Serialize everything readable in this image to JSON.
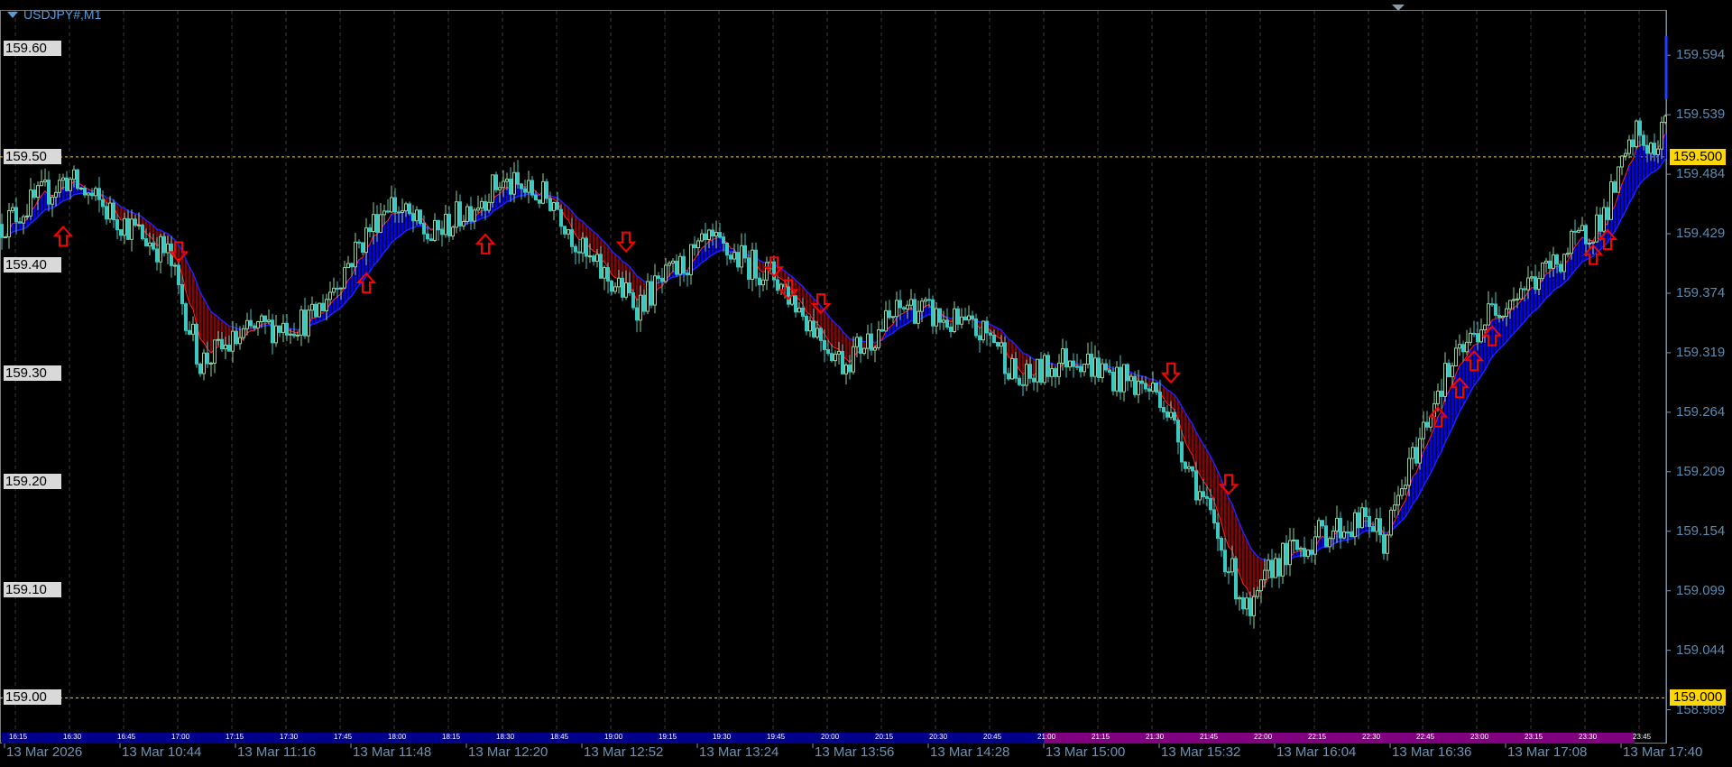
{
  "window": {
    "title": "USDJPY#,M1"
  },
  "left_levels": [
    "159.60",
    "159.50",
    "159.40",
    "159.30",
    "159.20",
    "159.10",
    "159.00"
  ],
  "price_axis": [
    "159.594",
    "159.539",
    "159.484",
    "159.429",
    "159.374",
    "159.319",
    "159.264",
    "159.209",
    "159.154",
    "159.099",
    "159.044",
    "158.989"
  ],
  "price_markers": [
    {
      "label": "159.500",
      "price": 159.5,
      "color": "#ffd700"
    },
    {
      "label": "159.000",
      "price": 159.0,
      "color": "#ffd700"
    }
  ],
  "time_axis": [
    "13 Mar 2026",
    "13 Mar 10:44",
    "13 Mar 11:16",
    "13 Mar 11:48",
    "13 Mar 12:20",
    "13 Mar 12:52",
    "13 Mar 13:24",
    "13 Mar 13:56",
    "13 Mar 14:28",
    "13 Mar 15:00",
    "13 Mar 15:32",
    "13 Mar 16:04",
    "13 Mar 16:36",
    "13 Mar 17:08",
    "13 Mar 17:40"
  ],
  "server_time_bar": {
    "labels": [
      "16:15",
      "16:30",
      "16:45",
      "17:00",
      "17:15",
      "17:30",
      "17:45",
      "18:00",
      "18:15",
      "18:30",
      "18:45",
      "19:00",
      "19:15",
      "19:30",
      "19:45",
      "20:00",
      "20:15",
      "20:30",
      "20:45",
      "21:00",
      "21:15",
      "21:30",
      "21:45",
      "22:00",
      "22:15",
      "22:30",
      "22:45",
      "23:00",
      "23:15",
      "23:30",
      "23:45"
    ],
    "colors": {
      "before_21": "#00008b",
      "after_21": "#800080"
    }
  },
  "colors": {
    "bull": "#8fd19e",
    "bear": "#3cc8c0",
    "fill_up": "#0000ff",
    "fill_down": "#8b0000",
    "ma_fast": "#ff2020",
    "ma_slow": "#2020ff",
    "arrow": "#ff0000",
    "grid": "#3a3a3a"
  },
  "chart_data": {
    "type": "candlestick",
    "symbol": "USDJPY#",
    "timeframe": "M1",
    "ylim": [
      158.98,
      159.61
    ],
    "price_path": [
      [
        "10:12",
        159.44
      ],
      [
        "10:29",
        159.48
      ],
      [
        "10:42",
        159.446
      ],
      [
        "10:57",
        159.41
      ],
      [
        "11:06",
        159.31
      ],
      [
        "11:21",
        159.34
      ],
      [
        "11:37",
        159.35
      ],
      [
        "11:58",
        159.46
      ],
      [
        "12:10",
        159.425
      ],
      [
        "12:29",
        159.476
      ],
      [
        "12:44",
        159.46
      ],
      [
        "12:53",
        159.405
      ],
      [
        "13:07",
        159.364
      ],
      [
        "13:27",
        159.42
      ],
      [
        "13:45",
        159.39
      ],
      [
        "14:04",
        159.31
      ],
      [
        "14:22",
        159.364
      ],
      [
        "14:31",
        159.35
      ],
      [
        "14:46",
        159.333
      ],
      [
        "14:53",
        159.29
      ],
      [
        "15:08",
        159.318
      ],
      [
        "15:17",
        159.3
      ],
      [
        "15:32",
        159.282
      ],
      [
        "15:57",
        159.072
      ],
      [
        "16:03",
        159.123
      ],
      [
        "16:18",
        159.154
      ],
      [
        "16:30",
        159.164
      ],
      [
        "16:34",
        159.144
      ],
      [
        "16:49",
        159.287
      ],
      [
        "17:04",
        159.359
      ],
      [
        "17:19",
        159.394
      ],
      [
        "17:35",
        159.446
      ],
      [
        "17:44",
        159.522
      ],
      [
        "17:50",
        159.5
      ],
      [
        "17:52",
        159.543
      ]
    ],
    "signals": [
      {
        "dir": "up",
        "time": "10:28",
        "price": 159.427
      },
      {
        "dir": "up",
        "time": "11:52",
        "price": 159.384
      },
      {
        "dir": "up",
        "time": "12:25",
        "price": 159.42
      },
      {
        "dir": "up",
        "time": "16:49",
        "price": 159.26
      },
      {
        "dir": "up",
        "time": "16:55",
        "price": 159.287
      },
      {
        "dir": "up",
        "time": "16:59",
        "price": 159.312
      },
      {
        "dir": "up",
        "time": "17:04",
        "price": 159.335
      },
      {
        "dir": "up",
        "time": "17:32",
        "price": 159.41
      },
      {
        "dir": "up",
        "time": "17:36",
        "price": 159.424
      },
      {
        "dir": "down",
        "time": "11:00",
        "price": 159.412
      },
      {
        "dir": "down",
        "time": "13:04",
        "price": 159.421
      },
      {
        "dir": "down",
        "time": "13:45",
        "price": 159.398
      },
      {
        "dir": "down",
        "time": "13:49",
        "price": 159.377
      },
      {
        "dir": "down",
        "time": "13:58",
        "price": 159.364
      },
      {
        "dir": "down",
        "time": "15:35",
        "price": 159.3
      },
      {
        "dir": "down",
        "time": "15:51",
        "price": 159.197
      }
    ]
  }
}
